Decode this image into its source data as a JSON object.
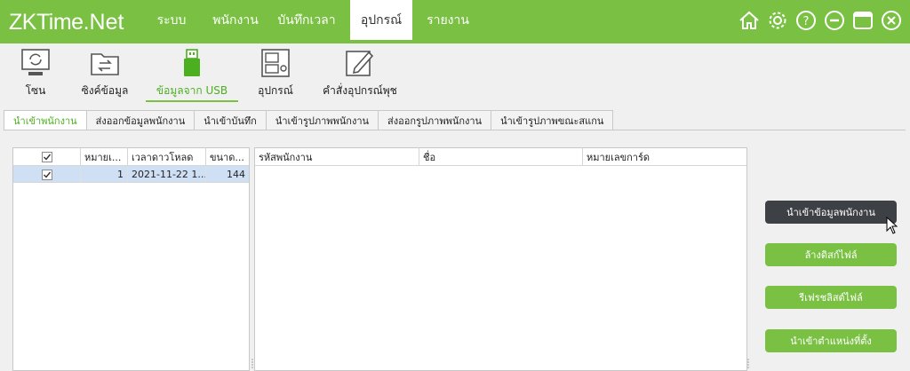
{
  "app": {
    "logo_main": "ZKTime",
    "logo_suffix": ".Net"
  },
  "menu": [
    {
      "label": "ระบบ"
    },
    {
      "label": "พนักงาน"
    },
    {
      "label": "บันทึกเวลา"
    },
    {
      "label": "อุปกรณ์"
    },
    {
      "label": "รายงาน"
    }
  ],
  "toolbar": [
    {
      "label": "โซน",
      "icon": "monitor-sync-icon"
    },
    {
      "label": "ซิงค์ข้อมูล",
      "icon": "folder-sync-icon"
    },
    {
      "label": "ข้อมูลจาก USB",
      "icon": "usb-drive-icon"
    },
    {
      "label": "อุปกรณ์",
      "icon": "device-icon"
    },
    {
      "label": "คำสั่งอุปกรณ์พุช",
      "icon": "edit-icon"
    }
  ],
  "tabs": [
    {
      "label": "นำเข้าพนักงาน"
    },
    {
      "label": "ส่งออกข้อมูลพนักงาน"
    },
    {
      "label": "นำเข้าบันทึก"
    },
    {
      "label": "นำเข้ารูปภาพพนักงาน"
    },
    {
      "label": "ส่งออกรูปภาพพนักงาน"
    },
    {
      "label": "นำเข้ารูปภาพขณะสแกน"
    }
  ],
  "left_grid": {
    "columns": [
      "",
      "หมายเ...",
      "เวลาดาวโหลด",
      "ขนาด..."
    ],
    "rows": [
      {
        "checked": true,
        "number": "1",
        "download_time": "2021-11-22 1...",
        "size": "144"
      }
    ]
  },
  "right_grid": {
    "columns": [
      "รหัสพนักงาน",
      "ชื่อ",
      "หมายเลขการ์ด"
    ]
  },
  "actions": {
    "import_employee": "นำเข้าข้อมูลพนักงาน",
    "clear_disk": "ล้างดิสก์ไฟล์",
    "refresh_file": "รีเฟรชลิสต์ไฟล์",
    "import_position": "นำเข้าตำแหน่งที่ตั้ง"
  },
  "colors": {
    "brand_green": "#7ac143",
    "dark_button": "#3d4044",
    "row_selected": "#cfe0f5"
  }
}
